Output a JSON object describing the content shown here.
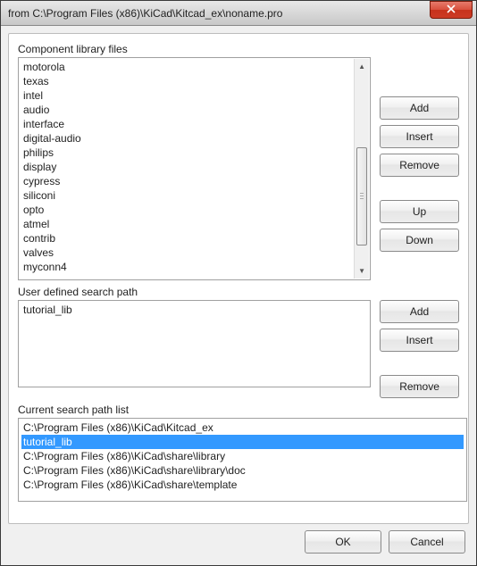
{
  "window": {
    "title": "from C:\\Program Files (x86)\\KiCad\\Kitcad_ex\\noname.pro"
  },
  "sections": {
    "label_component": "Component library files",
    "label_user_path": "User defined search path",
    "label_search_list": "Current search path list"
  },
  "component_libs": [
    "motorola",
    "texas",
    "intel",
    "audio",
    "interface",
    "digital-audio",
    "philips",
    "display",
    "cypress",
    "siliconi",
    "opto",
    "atmel",
    "contrib",
    "valves",
    "myconn4"
  ],
  "user_paths": [
    "tutorial_lib"
  ],
  "search_paths": {
    "items": [
      "C:\\Program Files (x86)\\KiCad\\Kitcad_ex",
      "tutorial_lib",
      "C:\\Program Files (x86)\\KiCad\\share\\library",
      "C:\\Program Files (x86)\\KiCad\\share\\library\\doc",
      "C:\\Program Files (x86)\\KiCad\\share\\template"
    ],
    "selected_index": 1
  },
  "buttons": {
    "add": "Add",
    "insert": "Insert",
    "remove": "Remove",
    "up": "Up",
    "down": "Down",
    "ok": "OK",
    "cancel": "Cancel"
  }
}
